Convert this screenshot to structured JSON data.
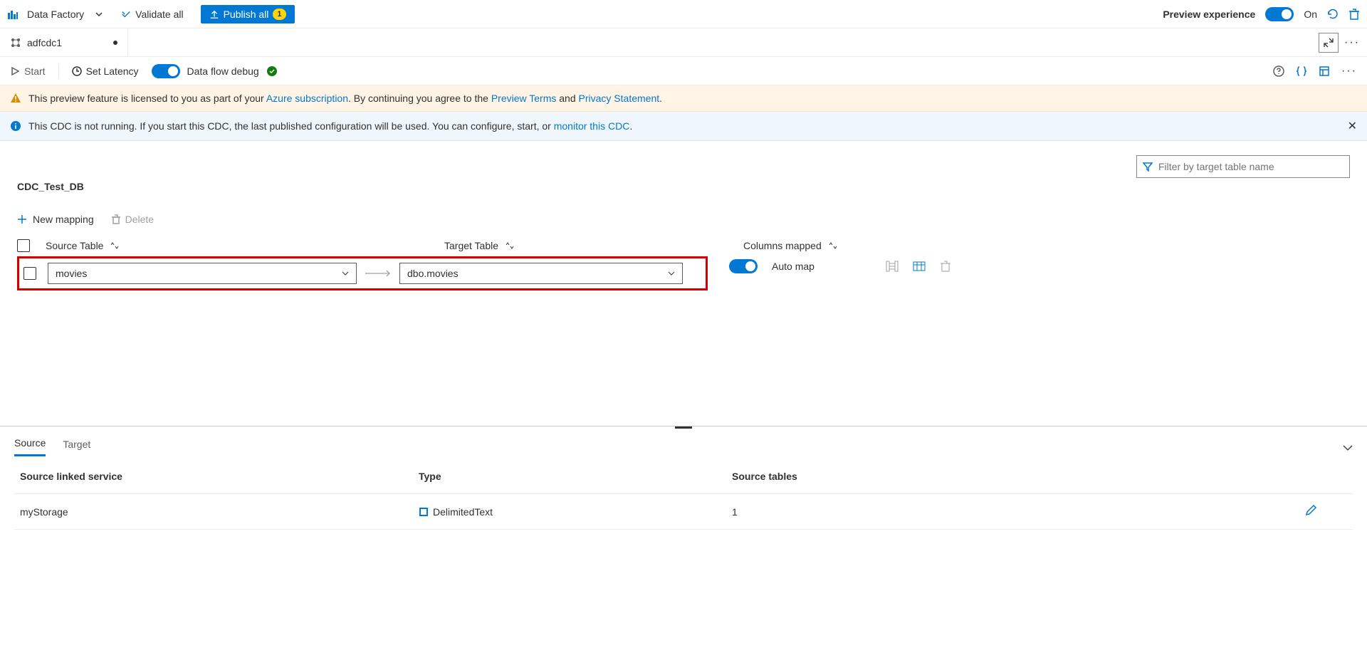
{
  "topbar": {
    "app": "Data Factory",
    "validate": "Validate all",
    "publish": "Publish all",
    "publish_count": "1",
    "preview_exp": "Preview experience",
    "preview_state": "On"
  },
  "tab": {
    "name": "adfcdc1"
  },
  "toolbar2": {
    "start": "Start",
    "latency": "Set Latency",
    "debug": "Data flow debug"
  },
  "banner_warn": {
    "pre": "This preview feature is licensed to you as part of your ",
    "link1": "Azure subscription",
    "mid1": ". By continuing you agree to the ",
    "link2": "Preview Terms",
    "mid2": " and ",
    "link3": "Privacy Statement",
    "end": "."
  },
  "banner_info": {
    "pre": "This CDC is not running. If you start this CDC, the last published configuration will be used. You can configure, start, or ",
    "link": "monitor this CDC",
    "end": "."
  },
  "filter": {
    "placeholder": "Filter by target table name"
  },
  "db_title": "CDC_Test_DB",
  "map_toolbar": {
    "new": "New mapping",
    "delete": "Delete"
  },
  "columns": {
    "source": "Source Table",
    "target": "Target Table",
    "mapped": "Columns mapped"
  },
  "row": {
    "source": "movies",
    "target": "dbo.movies",
    "automap": "Auto map"
  },
  "bottom": {
    "tabs": {
      "source": "Source",
      "target": "Target"
    },
    "head": {
      "service": "Source linked service",
      "type": "Type",
      "tables": "Source tables"
    },
    "cell": {
      "service": "myStorage",
      "type": "DelimitedText",
      "tables": "1"
    }
  }
}
